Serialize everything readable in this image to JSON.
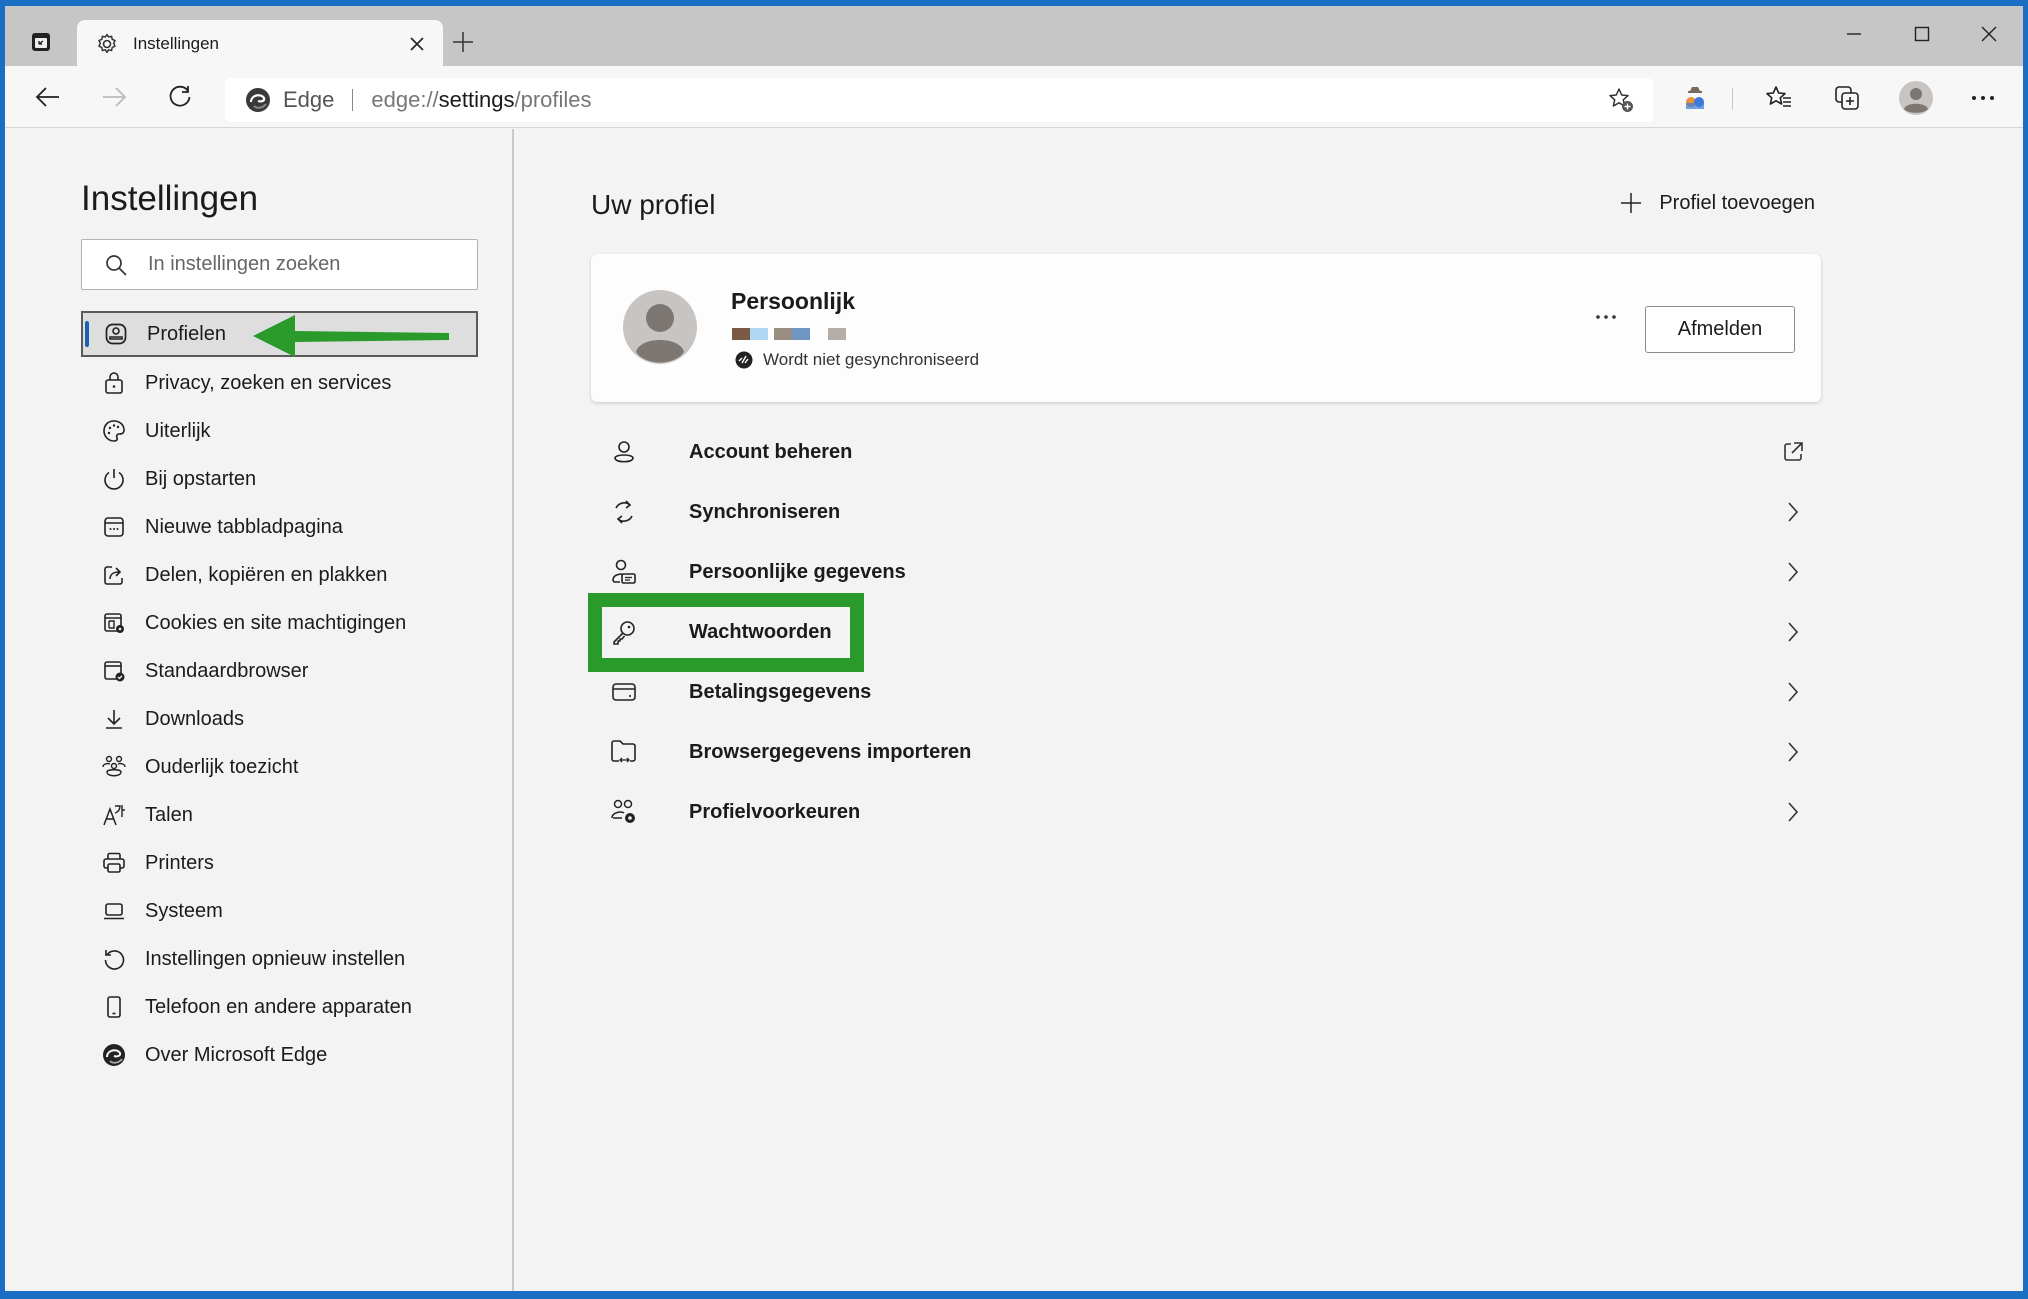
{
  "window": {
    "tab_title": "Instellingen",
    "tab_icon": "gear-icon",
    "new_tab_label": "+",
    "controls": [
      "minimize",
      "maximize",
      "close"
    ]
  },
  "toolbar": {
    "site_name": "Edge",
    "url_prefix": "edge://",
    "url_host": "settings",
    "url_path": "/profiles",
    "icons": [
      "back-icon",
      "forward-icon",
      "refresh-icon",
      "edge-logo-icon",
      "add-favorite-icon",
      "extension-icon",
      "favorites-icon",
      "collections-icon",
      "profile-avatar",
      "more-icon"
    ]
  },
  "sidebar": {
    "title": "Instellingen",
    "search_placeholder": "In instellingen zoeken",
    "items": [
      {
        "label": "Profielen",
        "icon": "profile-icon",
        "active": true
      },
      {
        "label": "Privacy, zoeken en services",
        "icon": "lock-icon"
      },
      {
        "label": "Uiterlijk",
        "icon": "palette-icon"
      },
      {
        "label": "Bij opstarten",
        "icon": "power-icon"
      },
      {
        "label": "Nieuwe tabbladpagina",
        "icon": "new-tab-page-icon"
      },
      {
        "label": "Delen, kopiëren en plakken",
        "icon": "share-icon"
      },
      {
        "label": "Cookies en site machtigingen",
        "icon": "cookies-icon"
      },
      {
        "label": "Standaardbrowser",
        "icon": "default-browser-icon"
      },
      {
        "label": "Downloads",
        "icon": "download-icon"
      },
      {
        "label": "Ouderlijk toezicht",
        "icon": "family-icon"
      },
      {
        "label": "Talen",
        "icon": "language-icon"
      },
      {
        "label": "Printers",
        "icon": "printer-icon"
      },
      {
        "label": "Systeem",
        "icon": "laptop-icon"
      },
      {
        "label": "Instellingen opnieuw instellen",
        "icon": "reset-icon"
      },
      {
        "label": "Telefoon en andere apparaten",
        "icon": "phone-icon"
      },
      {
        "label": "Over Microsoft Edge",
        "icon": "edge-logo-icon"
      }
    ]
  },
  "main": {
    "title": "Uw profiel",
    "add_profile_label": "Profiel toevoegen",
    "profile": {
      "name": "Persoonlijk",
      "email_redacted_colors": [
        "#7a5a44",
        "#aed8f2",
        "#9a8d82",
        "#6f95c2",
        "#b5ada8"
      ],
      "sync_status": "Wordt niet gesynchroniseerd",
      "more_label": "···",
      "signout_label": "Afmelden"
    },
    "rows": [
      {
        "label": "Account beheren",
        "icon": "account-icon",
        "trail": "external-link-icon"
      },
      {
        "label": "Synchroniseren",
        "icon": "sync-icon",
        "trail": "chevron-right-icon"
      },
      {
        "label": "Persoonlijke gegevens",
        "icon": "personal-info-icon",
        "trail": "chevron-right-icon"
      },
      {
        "label": "Wachtwoorden",
        "icon": "key-icon",
        "trail": "chevron-right-icon",
        "highlighted": true
      },
      {
        "label": "Betalingsgegevens",
        "icon": "credit-card-icon",
        "trail": "chevron-right-icon"
      },
      {
        "label": "Browsergegevens importeren",
        "icon": "import-icon",
        "trail": "chevron-right-icon"
      },
      {
        "label": "Profielvoorkeuren",
        "icon": "profile-preferences-icon",
        "trail": "chevron-right-icon"
      }
    ]
  },
  "annotations": {
    "highlight_color": "#2a9b2a",
    "arrow_target": "Profielen",
    "box_target": "Wachtwoorden"
  }
}
